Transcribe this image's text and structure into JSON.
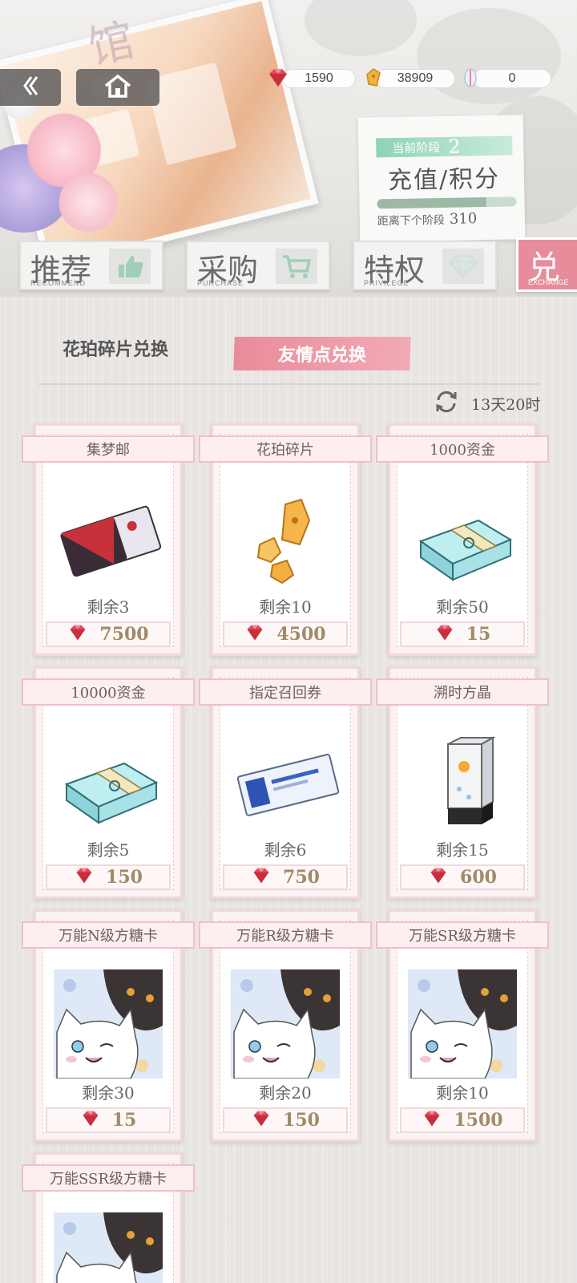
{
  "header": {
    "title_deco": "馆",
    "currencies": [
      {
        "icon": "ruby-gem-icon",
        "value": "1590"
      },
      {
        "icon": "amber-shard-icon",
        "value": "38909"
      },
      {
        "icon": "feather-token-icon",
        "value": "0"
      }
    ],
    "stage": {
      "label": "当前阶段",
      "number": "2",
      "title": "充值/积分",
      "progress": 0.78,
      "next_label": "距离下个阶段",
      "next_value": "310"
    }
  },
  "tabs": [
    {
      "label": "推荐",
      "sub": "RECOMMEND",
      "icon": "thumbs-up-icon"
    },
    {
      "label": "采购",
      "sub": "PURCHASE",
      "icon": "cart-icon"
    },
    {
      "label": "特权",
      "sub": "PRIVILEGE",
      "icon": "diamond-icon"
    },
    {
      "label": "兑换",
      "sub": "EXCHANGE",
      "icon": ""
    }
  ],
  "subtabs": {
    "left": "花珀碎片兑换",
    "right": "友情点兑换"
  },
  "timer": "13天20时",
  "items": [
    {
      "name": "集梦邮",
      "remain": "剩余3",
      "price": "7500",
      "art": "ticket-envelope-icon"
    },
    {
      "name": "花珀碎片",
      "remain": "剩余10",
      "price": "4500",
      "art": "amber-shards-icon"
    },
    {
      "name": "1000资金",
      "remain": "剩余50",
      "price": "15",
      "art": "cash-stack-icon"
    },
    {
      "name": "10000资金",
      "remain": "剩余5",
      "price": "150",
      "art": "cash-stack-icon"
    },
    {
      "name": "指定召回券",
      "remain": "剩余6",
      "price": "750",
      "art": "recall-ticket-icon"
    },
    {
      "name": "溯时方晶",
      "remain": "剩余15",
      "price": "600",
      "art": "crystal-prism-icon"
    },
    {
      "name": "万能N级方糖卡",
      "remain": "剩余30",
      "price": "15",
      "art": "cat-card-icon"
    },
    {
      "name": "万能R级方糖卡",
      "remain": "剩余20",
      "price": "150",
      "art": "cat-card-icon"
    },
    {
      "name": "万能SR级方糖卡",
      "remain": "剩余10",
      "price": "1500",
      "art": "cat-card-icon"
    },
    {
      "name": "万能SSR级方糖卡",
      "remain": "",
      "price": "",
      "art": "cat-card-icon"
    }
  ]
}
